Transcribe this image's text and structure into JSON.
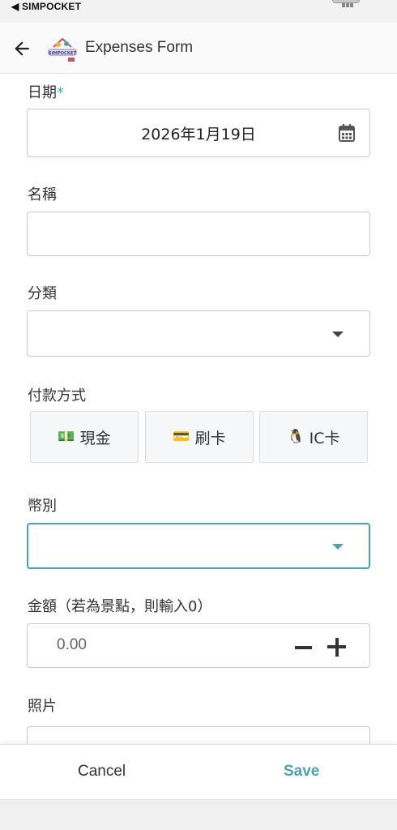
{
  "status_bar": {
    "back_label": "◀ SIMPOCKET"
  },
  "header": {
    "title": "Expenses Form",
    "logo_text": "SIMPOCKET"
  },
  "form": {
    "date_label": "日期",
    "date_required": "*",
    "date_value": "2026年1月19日",
    "name_label": "名稱",
    "name_value": "",
    "category_label": "分類",
    "category_value": "",
    "payment_label": "付款方式",
    "payment_options": [
      {
        "emoji": "💵",
        "label": "現金"
      },
      {
        "emoji": "💳",
        "label": "刷卡"
      },
      {
        "emoji": "🐧",
        "label": "IC卡"
      }
    ],
    "currency_label": "幣別",
    "currency_value": "",
    "amount_label": "金額（若為景點，則輸入0）",
    "amount_placeholder": "0.00",
    "photo_label": "照片"
  },
  "footer": {
    "cancel_label": "Cancel",
    "save_label": "Save"
  },
  "colors": {
    "accent": "#4aa3b5",
    "text": "#333333",
    "border": "#c9c9c9"
  },
  "icons": [
    "back-arrow-icon",
    "calendar-icon",
    "dropdown-arrow-icon",
    "minus-icon",
    "plus-icon",
    "cash-icon",
    "credit-card-icon",
    "penguin-icon"
  ]
}
